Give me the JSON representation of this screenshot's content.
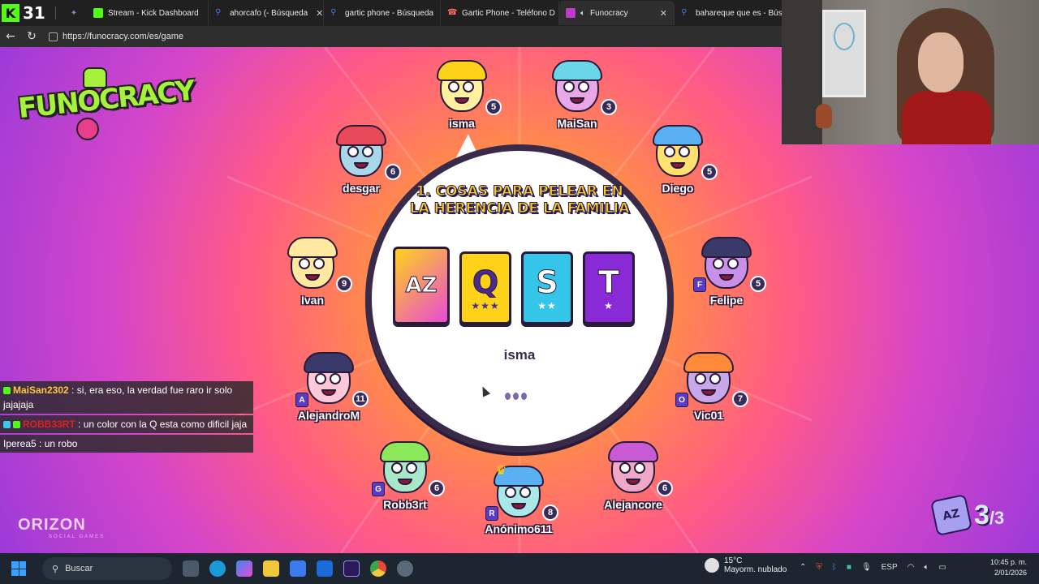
{
  "browser": {
    "tab_count": "31",
    "tabs": [
      {
        "label": "Stream - Kick Dashboard",
        "color": "#53fc18"
      },
      {
        "label": "ahorcafo (- Búsqueda",
        "color": "#3a7cf0"
      },
      {
        "label": "gartic phone - Búsqueda",
        "color": "#3a7cf0"
      },
      {
        "label": "Gartic Phone - Teléfono D",
        "color": "#ff6a6a"
      },
      {
        "label": "Funocracy",
        "color": "#c03ac8"
      },
      {
        "label": "bahareque que es - Búsq",
        "color": "#3a7cf0"
      }
    ],
    "url": "https://funocracy.com/es/game"
  },
  "game": {
    "logo": "FUNOCRACY",
    "brand": "ORIZON",
    "brand_sub": "SOCIAL GAMES",
    "prompt": "1. COSAS PARA PELEAR EN LA HERENCIA DE LA FAMILIA",
    "cards": [
      {
        "letter": "AZ",
        "stars": ""
      },
      {
        "letter": "Q",
        "stars": "★★★"
      },
      {
        "letter": "S",
        "stars": "★★"
      },
      {
        "letter": "T",
        "stars": "★"
      }
    ],
    "current_player": "isma",
    "round_current": "3",
    "round_total": "/3",
    "round_icon": "AZ"
  },
  "players": [
    {
      "name": "isma",
      "score": "5",
      "letter": "",
      "skin": "#fff0a0",
      "hair": "#ffd21a"
    },
    {
      "name": "MaiSan",
      "score": "3",
      "letter": "",
      "skin": "#e8a8e8",
      "hair": "#6ad6e8"
    },
    {
      "name": "Diego",
      "score": "5",
      "letter": "",
      "skin": "#ffe070",
      "hair": "#5ab0f0"
    },
    {
      "name": "desgar",
      "score": "6",
      "letter": "",
      "skin": "#a8d8e8",
      "hair": "#e84a5a"
    },
    {
      "name": "Ivan",
      "score": "9",
      "letter": "",
      "skin": "#ffe8a0",
      "hair": "#ffe8a0"
    },
    {
      "name": "Felipe",
      "score": "5",
      "letter": "F",
      "skin": "#c890e8",
      "hair": "#3a3a6a"
    },
    {
      "name": "AlejandroM",
      "score": "11",
      "letter": "A",
      "skin": "#ffc8d8",
      "hair": "#3a3a6a"
    },
    {
      "name": "Vic01",
      "score": "7",
      "letter": "O",
      "skin": "#c8a8e8",
      "hair": "#ff8a3a"
    },
    {
      "name": "Robb3rt",
      "score": "6",
      "letter": "G",
      "skin": "#a8e8c8",
      "hair": "#8ae85a"
    },
    {
      "name": "Anónimo611",
      "score": "8",
      "letter": "R",
      "skin": "#a8e8e8",
      "hair": "#5ab0f0"
    },
    {
      "name": "Alejancore",
      "score": "6",
      "letter": "",
      "skin": "#f0a8c8",
      "hair": "#c85ad6"
    }
  ],
  "chat": [
    {
      "user": "MaiSan2302",
      "sep": " : ",
      "text": "si, era eso, la verdad fue raro ir solo jajajaja",
      "user_color": "#ffc83a"
    },
    {
      "user": "ROBB33RT",
      "sep": " : ",
      "text": "un color con la Q esta como dificil jaja",
      "user_color": "#e02020"
    },
    {
      "user": "Iperea5",
      "sep": " : ",
      "text": "un robo",
      "user_color": "#ffffff"
    }
  ],
  "taskbar": {
    "search_label": "Buscar",
    "temperature": "15°C",
    "weather_desc": "Mayorm. nublado",
    "lang": "ESP",
    "time": "10:45 p. m.",
    "date": "2/01/2026"
  }
}
